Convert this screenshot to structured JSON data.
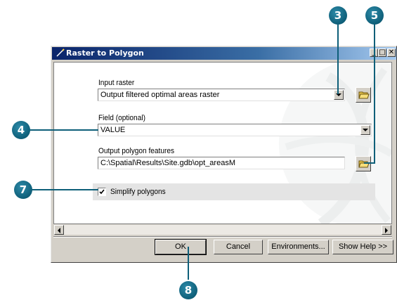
{
  "dialog": {
    "title": "Raster to Polygon",
    "window_buttons": {
      "minimize": "_",
      "maximize": "□",
      "close": "✕"
    }
  },
  "form": {
    "input_raster": {
      "label": "Input raster",
      "value": "Output filtered optimal areas raster"
    },
    "field": {
      "label": "Field (optional)",
      "value": "VALUE"
    },
    "output": {
      "label": "Output polygon features",
      "value": "C:\\Spatial\\Results\\Site.gdb\\opt_areasM"
    },
    "simplify": {
      "label": "Simplify polygons",
      "checked": true
    }
  },
  "buttons": {
    "ok": "OK",
    "cancel": "Cancel",
    "environments": "Environments...",
    "show_help": "Show Help >>"
  },
  "callouts": {
    "c3": "3",
    "c4": "4",
    "c5": "5",
    "c7": "7",
    "c8": "8"
  },
  "colors": {
    "callout": "#0e5f79",
    "titlebar": "#0a246a",
    "dialog_face": "#d4d0c8"
  }
}
